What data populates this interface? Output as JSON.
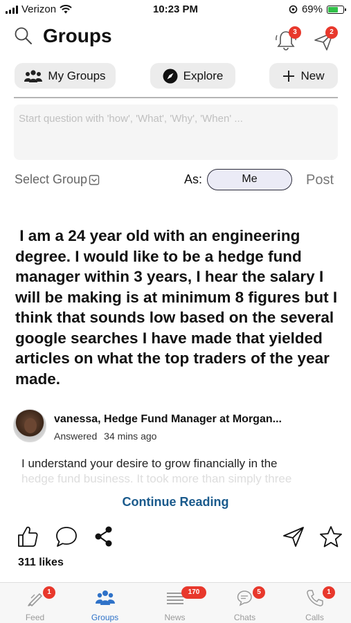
{
  "status_bar": {
    "carrier": "Verizon",
    "time": "10:23 PM",
    "battery_percent": "69%",
    "battery_level": 0.69,
    "icons": [
      "signal-icon",
      "wifi-icon",
      "location-icon",
      "battery-charging-icon"
    ]
  },
  "header": {
    "title": "Groups",
    "notifications_badge": "3",
    "messages_badge": "2"
  },
  "top_buttons": {
    "my_groups": "My Groups",
    "explore": "Explore",
    "new": "New"
  },
  "composer": {
    "placeholder": "Start question with 'how', 'What', 'Why', 'When' ...",
    "select_group": "Select Group",
    "as_label": "As:",
    "as_value": "Me",
    "post": "Post"
  },
  "question": {
    "text": " I am a 24 year old with an engineering degree. I would like to be a hedge fund manager within 3 years, I hear the salary I will be making is at minimum 8 figures but I think that sounds low based on the several google searches I have made that yielded articles on what the top traders of the year made."
  },
  "answer": {
    "author": "vanessa, Hedge Fund Manager at Morgan...",
    "status": "Answered",
    "time_ago": "34 mins ago",
    "line1": "I understand your desire to grow financially in the",
    "line2": "hedge fund business. It took more than simply three",
    "continue": "Continue Reading",
    "likes": "311 likes"
  },
  "tabs": [
    {
      "label": "Feed",
      "badge": "1",
      "icon": "feed-icon",
      "active": false
    },
    {
      "label": "Groups",
      "badge": "",
      "icon": "groups-icon",
      "active": true
    },
    {
      "label": "News",
      "badge": "170",
      "icon": "news-icon",
      "active": false
    },
    {
      "label": "Chats",
      "badge": "5",
      "icon": "chats-icon",
      "active": false
    },
    {
      "label": "Calls",
      "badge": "1",
      "icon": "calls-icon",
      "active": false
    }
  ],
  "colors": {
    "accent": "#2f72c8",
    "badge": "#e8382c",
    "link": "#1a5a8c",
    "battery": "#30c048"
  }
}
